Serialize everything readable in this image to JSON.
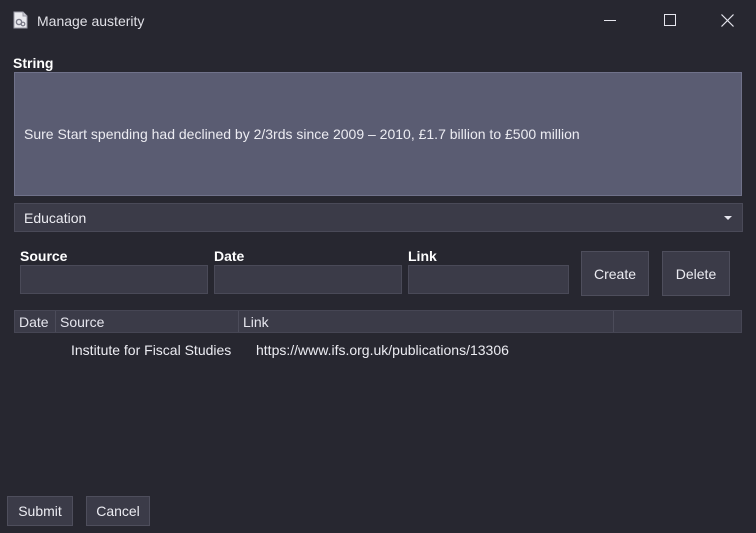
{
  "window": {
    "title": "Manage austerity",
    "app_icon": "document-gear-icon",
    "controls": [
      "minimize-icon",
      "maximize-icon",
      "close-icon"
    ]
  },
  "string_section": {
    "label": "String",
    "value": "Sure Start spending had declined by 2/3rds since 2009 – 2010, £1.7 billion to £500 million"
  },
  "category": {
    "selected": "Education"
  },
  "source_form": {
    "source_label": "Source",
    "date_label": "Date",
    "link_label": "Link",
    "source_value": "",
    "date_value": "",
    "link_value": "",
    "create_label": "Create",
    "delete_label": "Delete"
  },
  "sources_table": {
    "columns": [
      "Date",
      "Source",
      "Link"
    ],
    "rows": [
      {
        "date": "",
        "source": "Institute for Fiscal Studies",
        "link": "https://www.ifs.org.uk/publications/13306"
      }
    ]
  },
  "footer": {
    "submit_label": "Submit",
    "cancel_label": "Cancel"
  },
  "colors": {
    "background": "#272730",
    "string_box": "#5a5c72",
    "control": "#3b3b48"
  }
}
